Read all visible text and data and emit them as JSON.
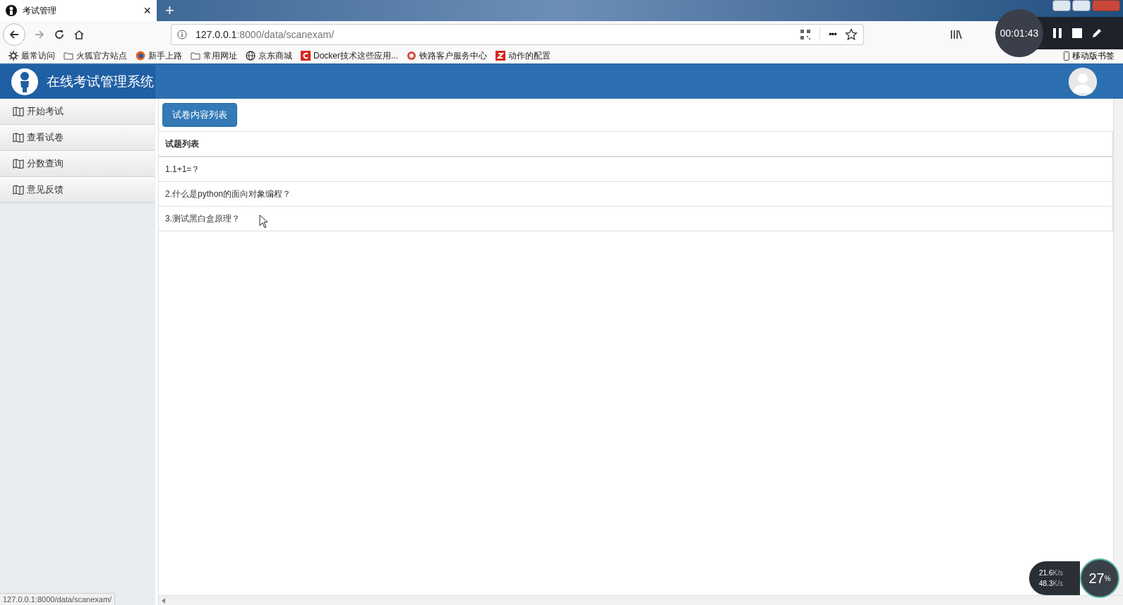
{
  "browser": {
    "tab": {
      "title": "考试管理",
      "close": "×"
    },
    "new_tab": "+",
    "url": {
      "host": "127.0.0.1",
      "rest": ":8000/data/scanexam/"
    },
    "more": "•••",
    "bookmarks": [
      {
        "label": "最常访问",
        "kind": "gear"
      },
      {
        "label": "火狐官方站点",
        "kind": "folder"
      },
      {
        "label": "新手上路",
        "kind": "firefox"
      },
      {
        "label": "常用网址",
        "kind": "folder"
      },
      {
        "label": "京东商城",
        "kind": "globe"
      },
      {
        "label": "Docker技术这些应用...",
        "kind": "c"
      },
      {
        "label": "铁路客户服务中心",
        "kind": "rail"
      },
      {
        "label": "动作的配置",
        "kind": "z"
      }
    ],
    "mobile_bookmarks": "移动版书签",
    "status_url": "127.0.0.1:8000/data/scanexam/"
  },
  "recorder": {
    "time": "00:01:43"
  },
  "app": {
    "title": "在线考试管理系统",
    "sidebar": [
      {
        "label": "开始考试"
      },
      {
        "label": "查看试卷"
      },
      {
        "label": "分数查询"
      },
      {
        "label": "意见反馈"
      }
    ],
    "button": "试卷内容列表",
    "panel_title": "试题列表",
    "questions": [
      "1.1+1=？",
      "2.什么是python的面向对象编程？",
      "3.测试黑白盒原理？"
    ]
  },
  "net_widget": {
    "up": "21.6",
    "up_unit": "K/s",
    "down": "48.3",
    "down_unit": "K/s",
    "cpu": "27",
    "cpu_unit": "%"
  }
}
